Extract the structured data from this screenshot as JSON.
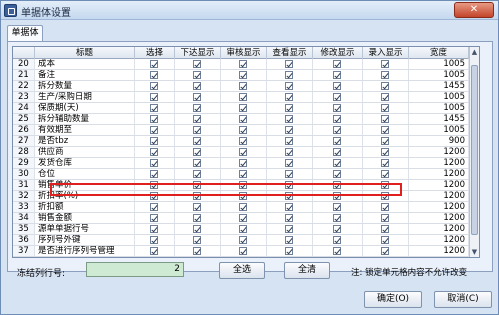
{
  "window": {
    "title": "单据体设置",
    "close_label": "✕"
  },
  "tab": {
    "label": "单据体"
  },
  "table": {
    "columns": [
      "标题",
      "选择",
      "下达显示",
      "审核显示",
      "查看显示",
      "修改显示",
      "录入显示",
      "宽度"
    ],
    "rows": [
      {
        "no": "20",
        "title": "成本",
        "checks": [
          true,
          true,
          true,
          true,
          true,
          true
        ],
        "width": "1005"
      },
      {
        "no": "21",
        "title": "备注",
        "checks": [
          true,
          true,
          true,
          true,
          true,
          true
        ],
        "width": "1005"
      },
      {
        "no": "22",
        "title": "拆分数量",
        "checks": [
          true,
          true,
          true,
          true,
          true,
          true
        ],
        "width": "1455"
      },
      {
        "no": "23",
        "title": "生产/采购日期",
        "checks": [
          true,
          true,
          true,
          true,
          true,
          true
        ],
        "width": "1005"
      },
      {
        "no": "24",
        "title": "保质期(天)",
        "checks": [
          true,
          true,
          true,
          true,
          true,
          true
        ],
        "width": "1005"
      },
      {
        "no": "25",
        "title": "拆分辅助数量",
        "checks": [
          true,
          true,
          true,
          true,
          true,
          true
        ],
        "width": "1455"
      },
      {
        "no": "26",
        "title": "有效期至",
        "checks": [
          true,
          true,
          true,
          true,
          true,
          true
        ],
        "width": "1005"
      },
      {
        "no": "27",
        "title": "是否tbz",
        "checks": [
          true,
          true,
          true,
          true,
          true,
          true
        ],
        "width": "900"
      },
      {
        "no": "28",
        "title": "供应商",
        "checks": [
          true,
          true,
          true,
          true,
          true,
          true
        ],
        "width": "1200"
      },
      {
        "no": "29",
        "title": "发货仓库",
        "checks": [
          true,
          true,
          true,
          true,
          true,
          true
        ],
        "width": "1200"
      },
      {
        "no": "30",
        "title": "仓位",
        "checks": [
          true,
          true,
          true,
          true,
          true,
          true
        ],
        "width": "1200"
      },
      {
        "no": "31",
        "title": "销售单价",
        "checks": [
          true,
          true,
          true,
          true,
          true,
          true
        ],
        "width": "1200"
      },
      {
        "no": "32",
        "title": "折扣率(%)",
        "checks": [
          true,
          true,
          true,
          true,
          true,
          true
        ],
        "width": "1200"
      },
      {
        "no": "33",
        "title": "折扣额",
        "checks": [
          true,
          true,
          true,
          true,
          true,
          true
        ],
        "width": "1200"
      },
      {
        "no": "34",
        "title": "销售金额",
        "checks": [
          true,
          true,
          true,
          true,
          true,
          true
        ],
        "width": "1200"
      },
      {
        "no": "35",
        "title": "源单单据行号",
        "checks": [
          true,
          true,
          true,
          true,
          true,
          true
        ],
        "width": "1200"
      },
      {
        "no": "36",
        "title": "序列号外键",
        "checks": [
          true,
          true,
          true,
          true,
          true,
          true
        ],
        "width": "1200"
      },
      {
        "no": "37",
        "title": "是否进行序列号管理",
        "checks": [
          true,
          true,
          true,
          true,
          true,
          true
        ],
        "width": "1200"
      }
    ]
  },
  "footer": {
    "freeze_label": "冻结列行号:",
    "freeze_value": "2",
    "select_all": "全选",
    "clear_all": "全清",
    "note": "注: 锁定单元格内容不允许改变",
    "ok": "确定(O)",
    "cancel": "取消(C)"
  }
}
